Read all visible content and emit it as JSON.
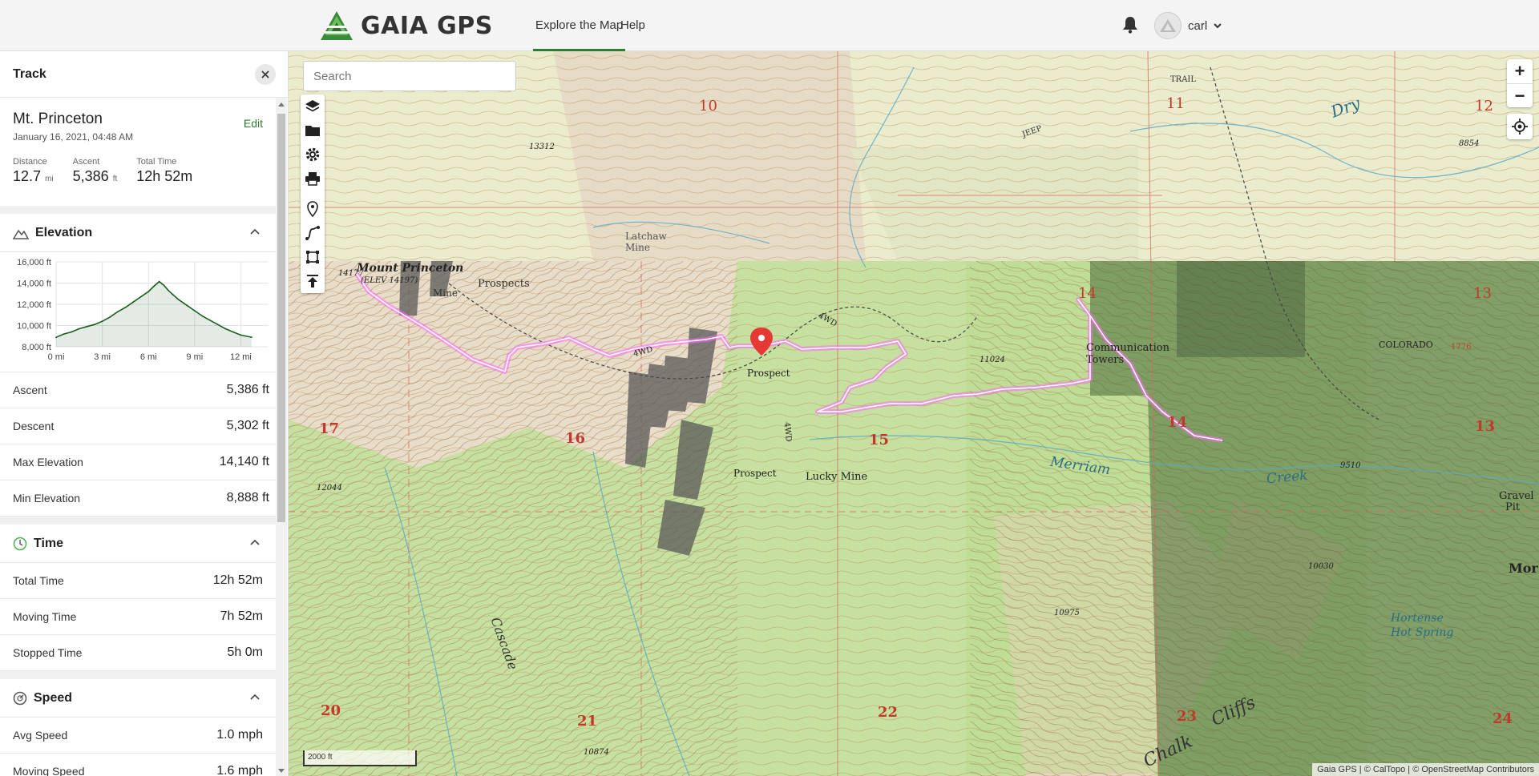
{
  "header": {
    "logo_text": "GAIA GPS",
    "nav": [
      {
        "label": "Explore the Map"
      },
      {
        "label": "Help"
      }
    ],
    "username": "carl"
  },
  "sidebar": {
    "title": "Track",
    "track": {
      "name": "Mt. Princeton",
      "edit_label": "Edit",
      "date": "January 16, 2021, 04:48 AM",
      "stats": [
        {
          "label": "Distance",
          "value": "12.7",
          "unit": "mi"
        },
        {
          "label": "Ascent",
          "value": "5,386",
          "unit": "ft"
        },
        {
          "label": "Total Time",
          "value": "12h 52m",
          "unit": ""
        }
      ]
    },
    "elevation": {
      "title": "Elevation",
      "rows": [
        {
          "label": "Ascent",
          "value": "5,386 ft"
        },
        {
          "label": "Descent",
          "value": "5,302 ft"
        },
        {
          "label": "Max Elevation",
          "value": "14,140 ft"
        },
        {
          "label": "Min Elevation",
          "value": "8,888 ft"
        }
      ]
    },
    "time": {
      "title": "Time",
      "rows": [
        {
          "label": "Total Time",
          "value": "12h 52m"
        },
        {
          "label": "Moving Time",
          "value": "7h 52m"
        },
        {
          "label": "Stopped Time",
          "value": "5h 0m"
        }
      ]
    },
    "speed": {
      "title": "Speed",
      "rows": [
        {
          "label": "Avg Speed",
          "value": "1.0 mph"
        },
        {
          "label": "Moving Speed",
          "value": "1.6 mph"
        }
      ]
    }
  },
  "chart_data": {
    "type": "area",
    "yticks": [
      "16,000 ft",
      "14,000 ft",
      "12,000 ft",
      "10,000 ft",
      "8,000 ft"
    ],
    "xticks": [
      "0 mi",
      "3 mi",
      "6 mi",
      "9 mi",
      "12 mi"
    ],
    "ylim": [
      8000,
      16000
    ],
    "xlim": [
      0,
      13.8
    ],
    "x": [
      0,
      0.5,
      1,
      1.5,
      2,
      2.5,
      3,
      3.5,
      4,
      4.5,
      5,
      5.5,
      6,
      6.35,
      6.7,
      7,
      7.3,
      7.6,
      8,
      8.5,
      9,
      9.5,
      10,
      10.5,
      11,
      11.5,
      12,
      12.7
    ],
    "values": [
      8888,
      9200,
      9400,
      9700,
      9900,
      10100,
      10400,
      10800,
      11300,
      11700,
      12200,
      12700,
      13200,
      13700,
      14140,
      13800,
      13300,
      12900,
      12400,
      11900,
      11400,
      10900,
      10500,
      10100,
      9700,
      9400,
      9100,
      8900
    ],
    "color": "#1b5e20"
  },
  "map": {
    "search_placeholder": "Search",
    "zoom_in": "+",
    "zoom_out": "−",
    "scale_label": "2000 ft",
    "attribution": "Gaia GPS | © CalTopo | © OpenStreetMap Contributors",
    "labels": {
      "mount": "Mount Princeton",
      "elev": "(ELEV 14197)",
      "mine": "Mine",
      "prospects": "Prospects",
      "latchaw": "Latchaw",
      "latchaw2": "Mine",
      "prospect1": "Prospect",
      "prospect2": "Prospect",
      "lucky": "Lucky Mine",
      "comm": "Communication",
      "towers": "Towers",
      "merriam": "Merriam",
      "creek": "Creek",
      "cascade": "Cascade",
      "chalk": "Chalk",
      "cliffs": "Cliffs",
      "hortense": "Hortense",
      "hot_spring": "Hot Spring",
      "colorado": "COLORADO",
      "trail": "TRAIL",
      "jeep": "JEEP",
      "dry": "Dry",
      "gravel": "Gravel",
      "pit": "Pit",
      "mor": "Mor",
      "e14177": "14177",
      "e13312": "13312",
      "e11024": "11024",
      "e10975": "10975",
      "e12044": "12044",
      "e10874": "10874",
      "e10030": "10030",
      "e8854": "8854",
      "e9510": "9510",
      "e1776": "1776",
      "wd1": "4WD",
      "wd2": "4WD",
      "wd3": "4WD"
    },
    "sections": [
      "10",
      "11",
      "12",
      "14",
      "13",
      "17",
      "16",
      "15",
      "14",
      "13",
      "20",
      "21",
      "22",
      "23",
      "24"
    ]
  }
}
